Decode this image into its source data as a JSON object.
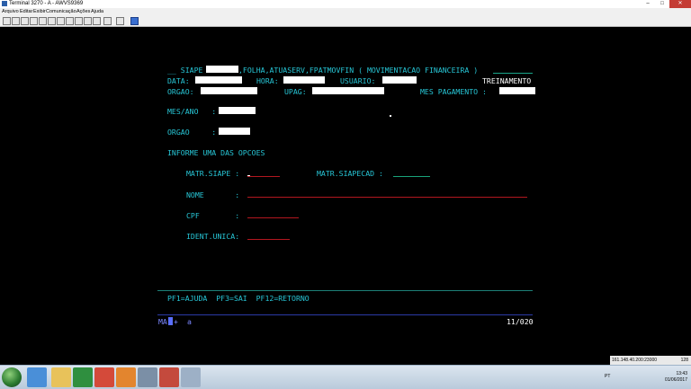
{
  "window": {
    "title": "Terminal 3270 - A - AWVS9369",
    "buttons": {
      "min": "–",
      "max": "□",
      "close": "✕"
    }
  },
  "menu": [
    "Arquivo",
    "Editar",
    "Exibir",
    "Comunicação",
    "Ações",
    "Ajuda"
  ],
  "screen": {
    "header": "__ SIAPE",
    "header_rest": ",FOLHA,ATUASERV,FPATMOVFIN ( MOVIMENTACAO FINANCEIRA )",
    "data_label": "DATA:",
    "hora_label": "HORA:",
    "usuario_label": "USUARIO:",
    "ambiente": "TREINAMENTO",
    "orgao_label": "ORGAO:",
    "upag_label": "UPAG:",
    "mes_pagamento_label": "MES PAGAMENTO :",
    "mes_ano_label": "MES/ANO   :",
    "orgao2_label": "ORGAO     :",
    "informe": "INFORME UMA DAS OPCOES",
    "matr_siape_label": "MATR.SIAPE :",
    "matr_siapecad_label": "MATR.SIAPECAD :",
    "nome_label": "NOME       :",
    "cpf_label": "CPF        :",
    "ident_unica_label": "IDENT.UNICA:",
    "pf_keys": "PF1=AJUDA  PF3=SAI  PF12=RETORNO",
    "status_ma": "MA",
    "status_plus": "+",
    "status_a": "a",
    "cursor_pos": "11/020"
  },
  "tray": {
    "lang": "PT",
    "time": "13:43",
    "date": "01/06/2017",
    "host": "161.148.40.200:23000",
    "page": "128"
  },
  "colors": {
    "screen_text": "#27c6d6",
    "masked_field": "#ffffff",
    "required_underline": "#b3171f",
    "optional_underline": "#1aa37a"
  }
}
